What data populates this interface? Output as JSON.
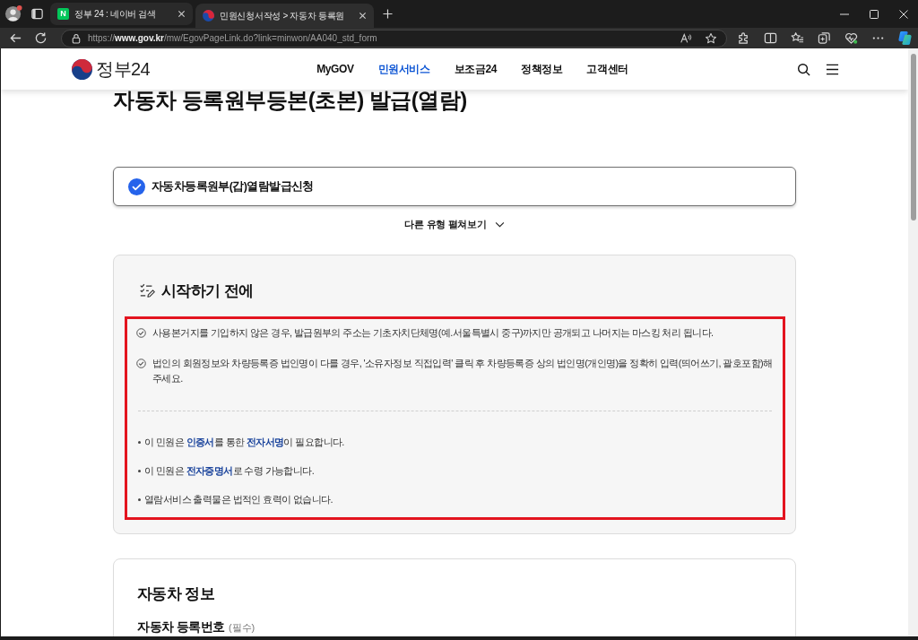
{
  "browser": {
    "tabs": [
      {
        "title": "정부 24 : 네이버 검색",
        "selected": false,
        "kind": "letter",
        "favicon_text": "N"
      },
      {
        "title": "민원신청서작성 > 자동차 등록원",
        "selected": true,
        "kind": "emblem"
      }
    ],
    "url": "https://**www.gov.kr**/mw/EgovPageLink.do?link=minwon/AA040_std_form"
  },
  "header": {
    "logo_text": "정부24",
    "nav": [
      {
        "label": "MyGOV",
        "selected": false
      },
      {
        "label": "민원서비스",
        "selected": true
      },
      {
        "label": "보조금24",
        "selected": false
      },
      {
        "label": "정책정보",
        "selected": false
      },
      {
        "label": "고객센터",
        "selected": false
      }
    ]
  },
  "page_title": "자동차 등록원부등본(초본) 발급(열람)",
  "selected_type": {
    "label": "자동차등록원부(갑)열람발급신청",
    "checked": true
  },
  "expand_toggle": "다른 유형 펼쳐보기",
  "before_start": {
    "heading": "시작하기 전에",
    "highlighted": true,
    "checks": [
      "사용본거지를 기입하지 않은 경우, 발급원부의 주소는 기초자치단체명(예.서울특별시 중구)까지만 공개되고 나머지는 마스킹 처리 됩니다.",
      "법인의 회원정보와 차량등록증 법인명이 다를 경우, '소유자정보 직접입력' 클릭 후 차량등록증 상의 법인명(개인명)을 정확히 입력(띄어쓰기, 괄호포함)해 주세요."
    ],
    "bullets": [
      "이 민원은 **인증서**를 통한 **전자서명**이 필요합니다.",
      "이 민원은 **전자증명서**로 수령 가능합니다.",
      "열람서비스 출력물은 법적인 효력이 없습니다."
    ]
  },
  "vehicle_info": {
    "heading": "자동차 정보",
    "fields": [
      {
        "label": "자동차 등록번호",
        "note": "(필수)"
      }
    ]
  }
}
